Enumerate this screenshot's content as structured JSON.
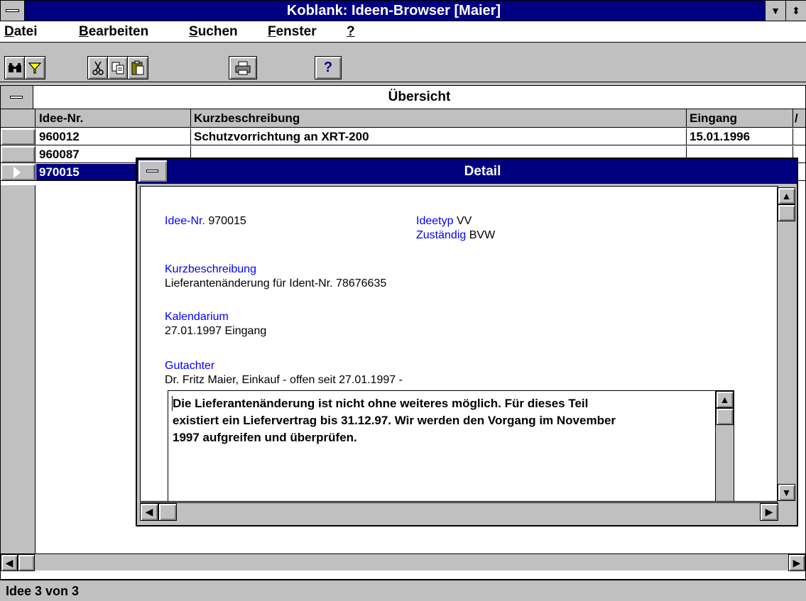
{
  "window": {
    "title": "Koblank: Ideen-Browser [Maier]",
    "menu_icon": "system-menu-icon",
    "minimize_icon": "minimize-arrow-icon",
    "restore_icon": "restore-arrows-icon"
  },
  "menu": {
    "items": [
      {
        "acc": "D",
        "rest": "atei"
      },
      {
        "acc": "B",
        "rest": "earbeiten"
      },
      {
        "acc": "S",
        "rest": "uchen"
      },
      {
        "acc": "F",
        "rest": "enster"
      },
      {
        "acc": "?",
        "rest": ""
      }
    ]
  },
  "toolbar": {
    "icons": [
      "binoculars-icon",
      "filter-icon",
      "cut-icon",
      "copy-icon",
      "paste-icon",
      "print-icon",
      "help-icon"
    ],
    "help_label": "?"
  },
  "overview": {
    "title": "Übersicht",
    "columns": [
      "Idee-Nr.",
      "Kurzbeschreibung",
      "Eingang",
      "/"
    ],
    "rows": [
      {
        "id": "960012",
        "desc": "Schutzvorrichtung an XRT-200",
        "date": "15.01.1996"
      },
      {
        "id": "960087",
        "desc": "",
        "date": ""
      },
      {
        "id": "970015",
        "desc": "",
        "date": ""
      }
    ],
    "selected_row": 2
  },
  "detail": {
    "title": "Detail",
    "idee_nr_label": "Idee-Nr.",
    "idee_nr_value": "970015",
    "ideetyp_label": "Ideetyp",
    "ideetyp_value": "VV",
    "zustaendig_label": "Zuständig",
    "zustaendig_value": "BVW",
    "kurzbeschreibung_label": "Kurzbeschreibung",
    "kurzbeschreibung_value": "Lieferantenänderung für Ident-Nr. 78676635",
    "kalendarium_label": "Kalendarium",
    "kalendarium_value": "27.01.1997 Eingang",
    "gutachter_label": "Gutachter",
    "gutachter_value": "Dr. Fritz Maier, Einkauf  - offen seit 27.01.1997 -",
    "memo_lines": [
      "Die Lieferantenänderung ist nicht ohne weiteres möglich. Für dieses Teil",
      "existiert ein Liefervertrag bis 31.12.97. Wir werden den Vorgang im November",
      "1997 aufgreifen und überprüfen."
    ]
  },
  "status": {
    "text": "Idee  3 von  3"
  },
  "colors": {
    "title_bar": "#000080",
    "chrome": "#c0c0c0",
    "label_blue": "#0000ff",
    "selection": "#000080"
  }
}
